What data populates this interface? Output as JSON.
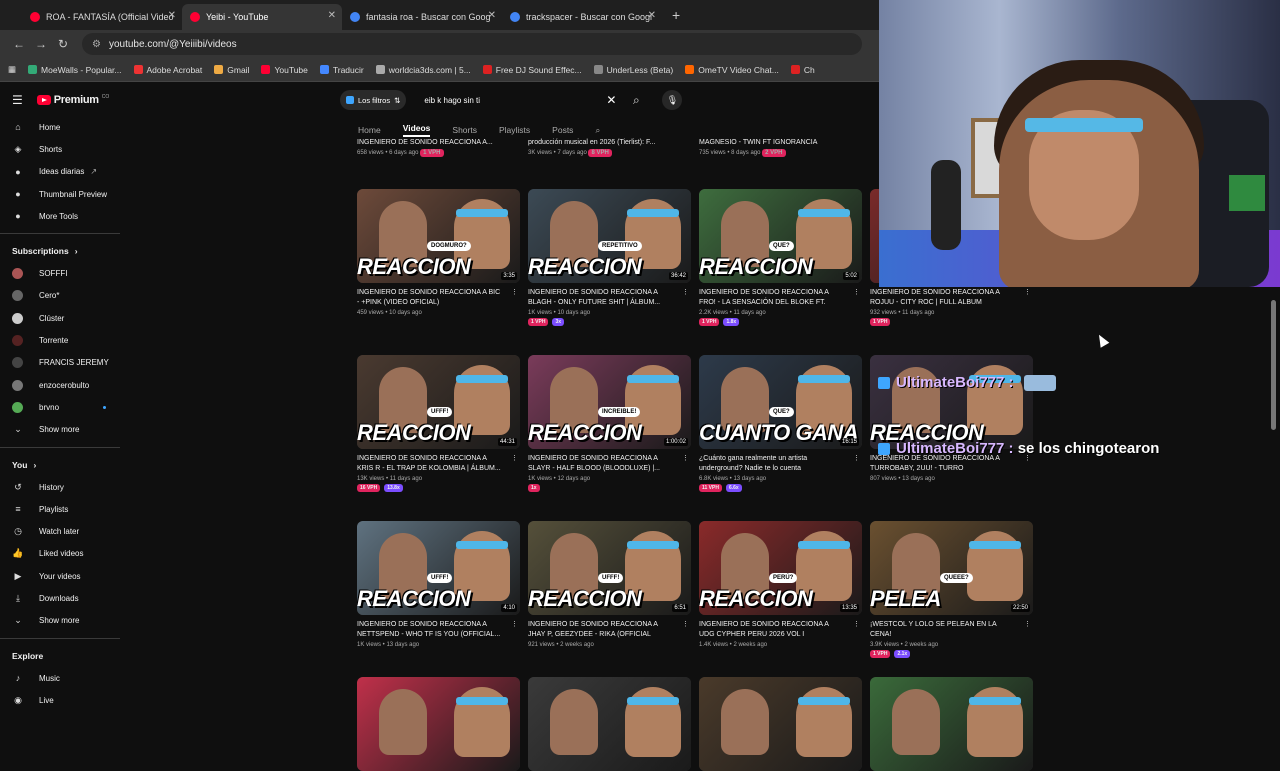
{
  "browser": {
    "tabs": [
      {
        "label": "ROA - FANTASÍA (Official Video",
        "color": "#ff0033"
      },
      {
        "label": "Yeibi - YouTube",
        "color": "#ff0033"
      },
      {
        "label": "fantasia roa - Buscar con Goog",
        "color": "#4285f4"
      },
      {
        "label": "trackspacer - Buscar con Googl",
        "color": "#4285f4"
      }
    ],
    "url": "youtube.com/@Yeiiibi/videos",
    "bookmarks": [
      "MoeWalls - Popular...",
      "Adobe Acrobat",
      "Gmail",
      "YouTube",
      "Traducir",
      "worldcia3ds.com | 5...",
      "Free DJ Sound Effec...",
      "UnderLess (Beta)",
      "OmeTV Video Chat...",
      "Ch"
    ]
  },
  "sidebar": {
    "logo_text": "Premium",
    "logo_cc": "CO",
    "main": [
      "Home",
      "Shorts",
      "Ideas diarias",
      "Thumbnail Preview",
      "More Tools"
    ],
    "subscriptions_title": "Subscriptions",
    "subscriptions": [
      "SOFFFI",
      "Cero*",
      "Clúster",
      "Torrente",
      "FRANCIS JEREMY",
      "enzocerobulto",
      "brvno"
    ],
    "show_more": "Show more",
    "you_title": "You",
    "you_items": [
      "History",
      "Playlists",
      "Watch later",
      "Liked videos",
      "Your videos",
      "Downloads"
    ],
    "show_more2": "Show more",
    "explore_title": "Explore",
    "explore_items": [
      "Music",
      "Live"
    ]
  },
  "search": {
    "filters_label": "Los filtros",
    "query": "eib k hago sin ti"
  },
  "channel_tabs": [
    "Home",
    "Videos",
    "Shorts",
    "Playlists",
    "Posts"
  ],
  "top_row": [
    {
      "title": "INGENIERO DE SONIDO REACCIONA A...",
      "meta": "658 views • 6 days ago",
      "badge": "1 VPH"
    },
    {
      "title": "producción musical en 2026 (Tierlist): F...",
      "meta": "3K views • 7 days ago",
      "badge": "8 VPH"
    },
    {
      "title": "MAGNESIO - TWIN FT IGNORANCIA",
      "meta": "735 views • 8 days ago",
      "badge": "2 VPH"
    }
  ],
  "videos": [
    {
      "big": "REACCION",
      "bubble": "DOGMURO?",
      "dur": "3:35",
      "title": "INGENIERO DE SONIDO REACCIONA A BIC - +PINK (VIDEO OFICIAL)",
      "meta": "459 views • 10 days ago",
      "badges": []
    },
    {
      "big": "REACCION",
      "bubble": "REPETITIVO",
      "dur": "36:42",
      "title": "INGENIERO DE SONIDO REACCIONA A BLAGH - ONLY FUTURE SHIT | ÁLBUM...",
      "meta": "1K views • 10 days ago",
      "badges": [
        "1 VPH",
        "3x"
      ]
    },
    {
      "big": "REACCION",
      "bubble": "QUE?",
      "dur": "5:02",
      "title": "INGENIERO DE SONIDO REACCIONA A FRO! - LA SENSACIÓN DEL BLOKE FT. PABLOXO",
      "meta": "2.2K views • 11 days ago",
      "badges": [
        "1 VPH",
        "1.8x"
      ]
    },
    {
      "big": "",
      "bubble": "",
      "dur": "",
      "title": "INGENIERO DE SONIDO REACCIONA A ROJUU - CITY ROC | FULL ALBUM",
      "meta": "932 views • 11 days ago",
      "badges": [
        "1 VPH"
      ]
    },
    {
      "big": "REACCION",
      "bubble": "UFFF!",
      "dur": "44:31",
      "title": "INGENIERO DE SONIDO REACCIONA A KRIS R - EL TRAP DE KOLOMBIA | ÁLBUM...",
      "meta": "13K views • 11 days ago",
      "badges": [
        "16 VPH",
        "13.8x"
      ]
    },
    {
      "big": "REACCION",
      "bubble": "INCREIBLE!",
      "dur": "1:00:02",
      "title": "INGENIERO DE SONIDO REACCIONA A SLAYR - HALF BLOOD (BLOODLUXE) |...",
      "meta": "1K views • 12 days ago",
      "badges": [
        "1x"
      ]
    },
    {
      "big": "CUANTO GANA",
      "bubble": "QUE?",
      "dur": "16:15",
      "title": "¿Cuánto gana realmente un artista underground? Nadie te lo cuenta",
      "meta": "6.8K views • 13 days ago",
      "badges": [
        "11 VPH",
        "6.6x"
      ]
    },
    {
      "big": "REACCION",
      "bubble": "",
      "dur": "",
      "title": "INGENIERO DE SONIDO REACCIONA A TURROBABY, 2UU! - TURRO",
      "meta": "807 views • 13 days ago",
      "badges": []
    },
    {
      "big": "REACCION",
      "bubble": "UFFF!",
      "dur": "4:10",
      "title": "INGENIERO DE SONIDO REACCIONA A NETTSPEND - WHO TF IS YOU (OFFICIAL...",
      "meta": "1K views • 13 days ago",
      "badges": []
    },
    {
      "big": "REACCION",
      "bubble": "UFFF!",
      "dur": "6:51",
      "title": "INGENIERO DE SONIDO REACCIONA A JHAY P, GEEZYDEE - RIKA (OFFICIAL VIDEO)",
      "meta": "921 views • 2 weeks ago",
      "badges": []
    },
    {
      "big": "REACCION",
      "bubble": "PERÚ?",
      "dur": "13:35",
      "title": "INGENIERO DE SONIDO REACCIONA A UDG CYPHER PERU 2026 VOL I",
      "meta": "1.4K views • 2 weeks ago",
      "badges": []
    },
    {
      "big": "PELEA",
      "bubble": "QUEEE?",
      "dur": "22:50",
      "title": "¡WESTCOL Y LOLO SE PELEAN EN LA CENA!",
      "meta": "3.9K views • 2 weeks ago",
      "badges": [
        "1 VPH",
        "2.1x"
      ]
    }
  ],
  "chat": [
    {
      "user": "UltimateBoi777",
      "sep": ":",
      "msg": ""
    },
    {
      "user": "UltimateBoi777",
      "sep": ":",
      "msg": "se los chingotearon"
    }
  ],
  "colors": {
    "accent": "#ff0033",
    "bg": "#0f0f0f",
    "vph_red": "#e0245e",
    "vph_purple": "#7b4dff"
  }
}
